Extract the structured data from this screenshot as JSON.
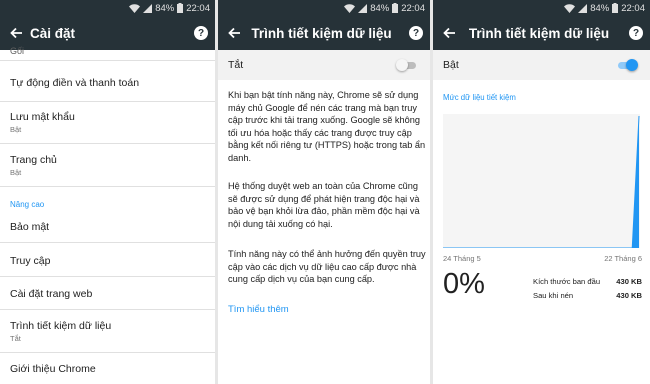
{
  "status_bar": {
    "battery_percent": "84%",
    "time": "22:04"
  },
  "screen1": {
    "title": "Cài đặt",
    "items": [
      {
        "label": "Gối",
        "sub": ""
      },
      {
        "label": "Tự động điền và thanh toán",
        "sub": ""
      },
      {
        "label": "Lưu mật khẩu",
        "sub": "Bật"
      },
      {
        "label": "Trang chủ",
        "sub": "Bật"
      }
    ],
    "section_label": "Nâng cao",
    "advanced_items": [
      {
        "label": "Bảo mật",
        "sub": ""
      },
      {
        "label": "Truy cập",
        "sub": ""
      },
      {
        "label": "Cài đặt trang web",
        "sub": ""
      },
      {
        "label": "Trình tiết kiệm dữ liệu",
        "sub": "Tắt"
      },
      {
        "label": "Giới thiệu Chrome",
        "sub": ""
      }
    ]
  },
  "screen2": {
    "title": "Trình tiết kiệm dữ liệu",
    "toggle_label": "Tắt",
    "toggle_on": false,
    "paragraphs": [
      "Khi bạn bật tính năng này, Chrome sẽ sử dụng máy chủ Google để nén các trang mà bạn truy cập trước khi tải trang xuống. Google sẽ không tối ưu hóa hoặc thấy các trang được truy cập bằng kết nối riêng tư (HTTPS) hoặc trong tab ẩn danh.",
      "Hệ thống duyệt web an toàn của Chrome cũng sẽ được sử dụng để phát hiện trang độc hại và bảo vệ bạn khỏi lừa đảo, phần mềm độc hại và nội dung tải xuống có hại.",
      "Tính năng này có thể ảnh hưởng đến quyền truy cập vào các dịch vụ dữ liệu cao cấp được nhà cung cấp dịch vụ của bạn cung cấp."
    ],
    "learn_more": "Tìm hiểu thêm"
  },
  "screen3": {
    "title": "Trình tiết kiệm dữ liệu",
    "toggle_label": "Bật",
    "toggle_on": true,
    "section_label": "Mức dữ liệu tiết kiệm",
    "date_start": "24 Tháng 5",
    "date_end": "22 Tháng 6",
    "percent_saved": "0%",
    "stats": [
      {
        "label": "Kích thước ban đầu",
        "value": "430 KB"
      },
      {
        "label": "Sau khi nén",
        "value": "430 KB"
      }
    ]
  },
  "colors": {
    "toolbar": "#263238",
    "accent": "#2196f3",
    "chart_bg": "#f5f5f5",
    "toggle_row_bg": "#f2f2f2"
  },
  "chart_data": {
    "type": "area",
    "x": [
      "24 Tháng 5",
      "22 Tháng 6"
    ],
    "series": [
      {
        "values": [
          0,
          0,
          0,
          0,
          0,
          0,
          0,
          0,
          0,
          0,
          0,
          0,
          0,
          0,
          0,
          0,
          0,
          0,
          0,
          0,
          0,
          0,
          0,
          0,
          0,
          0,
          0,
          0,
          0,
          430
        ]
      }
    ],
    "grid": false,
    "legend": "none"
  }
}
